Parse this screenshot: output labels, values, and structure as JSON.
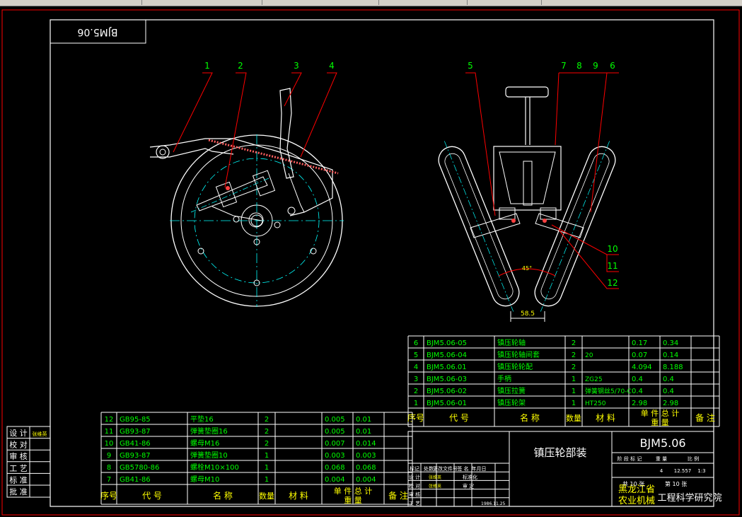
{
  "drawing_number": "BJM5.06",
  "assembly_name": "镇压轮部装",
  "org_line1": "黑龙江省",
  "org_line2": "农业机械",
  "org_line3": "工程科学研究院",
  "mark_labels": [
    "1",
    "2",
    "3",
    "4",
    "5",
    "7",
    "8",
    "9",
    "6",
    "10",
    "11",
    "12"
  ],
  "dim_width": "58.5",
  "dim_angle": "45°",
  "parts_upper": [
    {
      "no": "6",
      "code": "BJM5.06-05",
      "name": "镇压轮轴",
      "qty": "2",
      "mat": "",
      "unit": "0.17",
      "total": "0.34"
    },
    {
      "no": "5",
      "code": "BJM5.06-04",
      "name": "镇压轮轴间套",
      "qty": "2",
      "mat": "20",
      "unit": "0.07",
      "total": "0.14"
    },
    {
      "no": "4",
      "code": "BJM5.06.01",
      "name": "镇压轮轮配",
      "qty": "2",
      "mat": "",
      "unit": "4.094",
      "total": "8.188"
    },
    {
      "no": "3",
      "code": "BJM5.06-03",
      "name": "手柄",
      "qty": "1",
      "mat": "ZG25",
      "unit": "0.4",
      "total": "0.4"
    },
    {
      "no": "2",
      "code": "BJM5.06-02",
      "name": "镇压拉簧",
      "qty": "1",
      "mat": "弹簧钢丝5/70-C",
      "unit": "0.4",
      "total": "0.4"
    },
    {
      "no": "1",
      "code": "BJM5.06-01",
      "name": "镇压轮架",
      "qty": "1",
      "mat": "HT250",
      "unit": "2.98",
      "total": "2.98"
    }
  ],
  "parts_lower": [
    {
      "no": "12",
      "code": "GB95-85",
      "name": "平垫16",
      "qty": "2",
      "mat": "",
      "unit": "0.005",
      "total": "0.01"
    },
    {
      "no": "11",
      "code": "GB93-87",
      "name": "弹簧垫圈16",
      "qty": "2",
      "mat": "",
      "unit": "0.005",
      "total": "0.01"
    },
    {
      "no": "10",
      "code": "GB41-86",
      "name": "螺母M16",
      "qty": "2",
      "mat": "",
      "unit": "0.007",
      "total": "0.014"
    },
    {
      "no": "9",
      "code": "GB93-87",
      "name": "弹簧垫圈10",
      "qty": "1",
      "mat": "",
      "unit": "0.003",
      "total": "0.003"
    },
    {
      "no": "8",
      "code": "GB5780-86",
      "name": "螺栓M10×100",
      "qty": "1",
      "mat": "",
      "unit": "0.068",
      "total": "0.068"
    },
    {
      "no": "7",
      "code": "GB41-86",
      "name": "螺母M10",
      "qty": "1",
      "mat": "",
      "unit": "0.004",
      "total": "0.004"
    }
  ],
  "headers": {
    "no": "序号",
    "code": "代 号",
    "name": "名 称",
    "qty": "数量",
    "mat": "材 料",
    "weight_top": "单 件 总 计",
    "weight_bottom": "重 量",
    "remark": "备 注"
  },
  "sign_labels": [
    "设 计",
    "校 对",
    "审 核",
    "工 艺",
    "标 准",
    "批 准"
  ],
  "sign_name": "张维英",
  "title_block": {
    "rev_header": [
      "标记",
      "处数",
      "更改文件号",
      "签 名",
      "年月日"
    ],
    "rows": [
      [
        "设 计",
        "张维英",
        "标准化"
      ],
      [
        "校 对",
        "张维英",
        "审 定"
      ],
      [
        "审 核",
        "",
        ""
      ],
      [
        "工 艺",
        "",
        ""
      ]
    ],
    "date_value": "1986.11.25",
    "stage_header": [
      "阶 段 标 记",
      "重 量",
      "比 例"
    ],
    "weight_value": "12.557",
    "scale_value": "1:3",
    "stage_mark": "4",
    "sheet_total": "共 10 张",
    "sheet_no": "第 10 张"
  }
}
